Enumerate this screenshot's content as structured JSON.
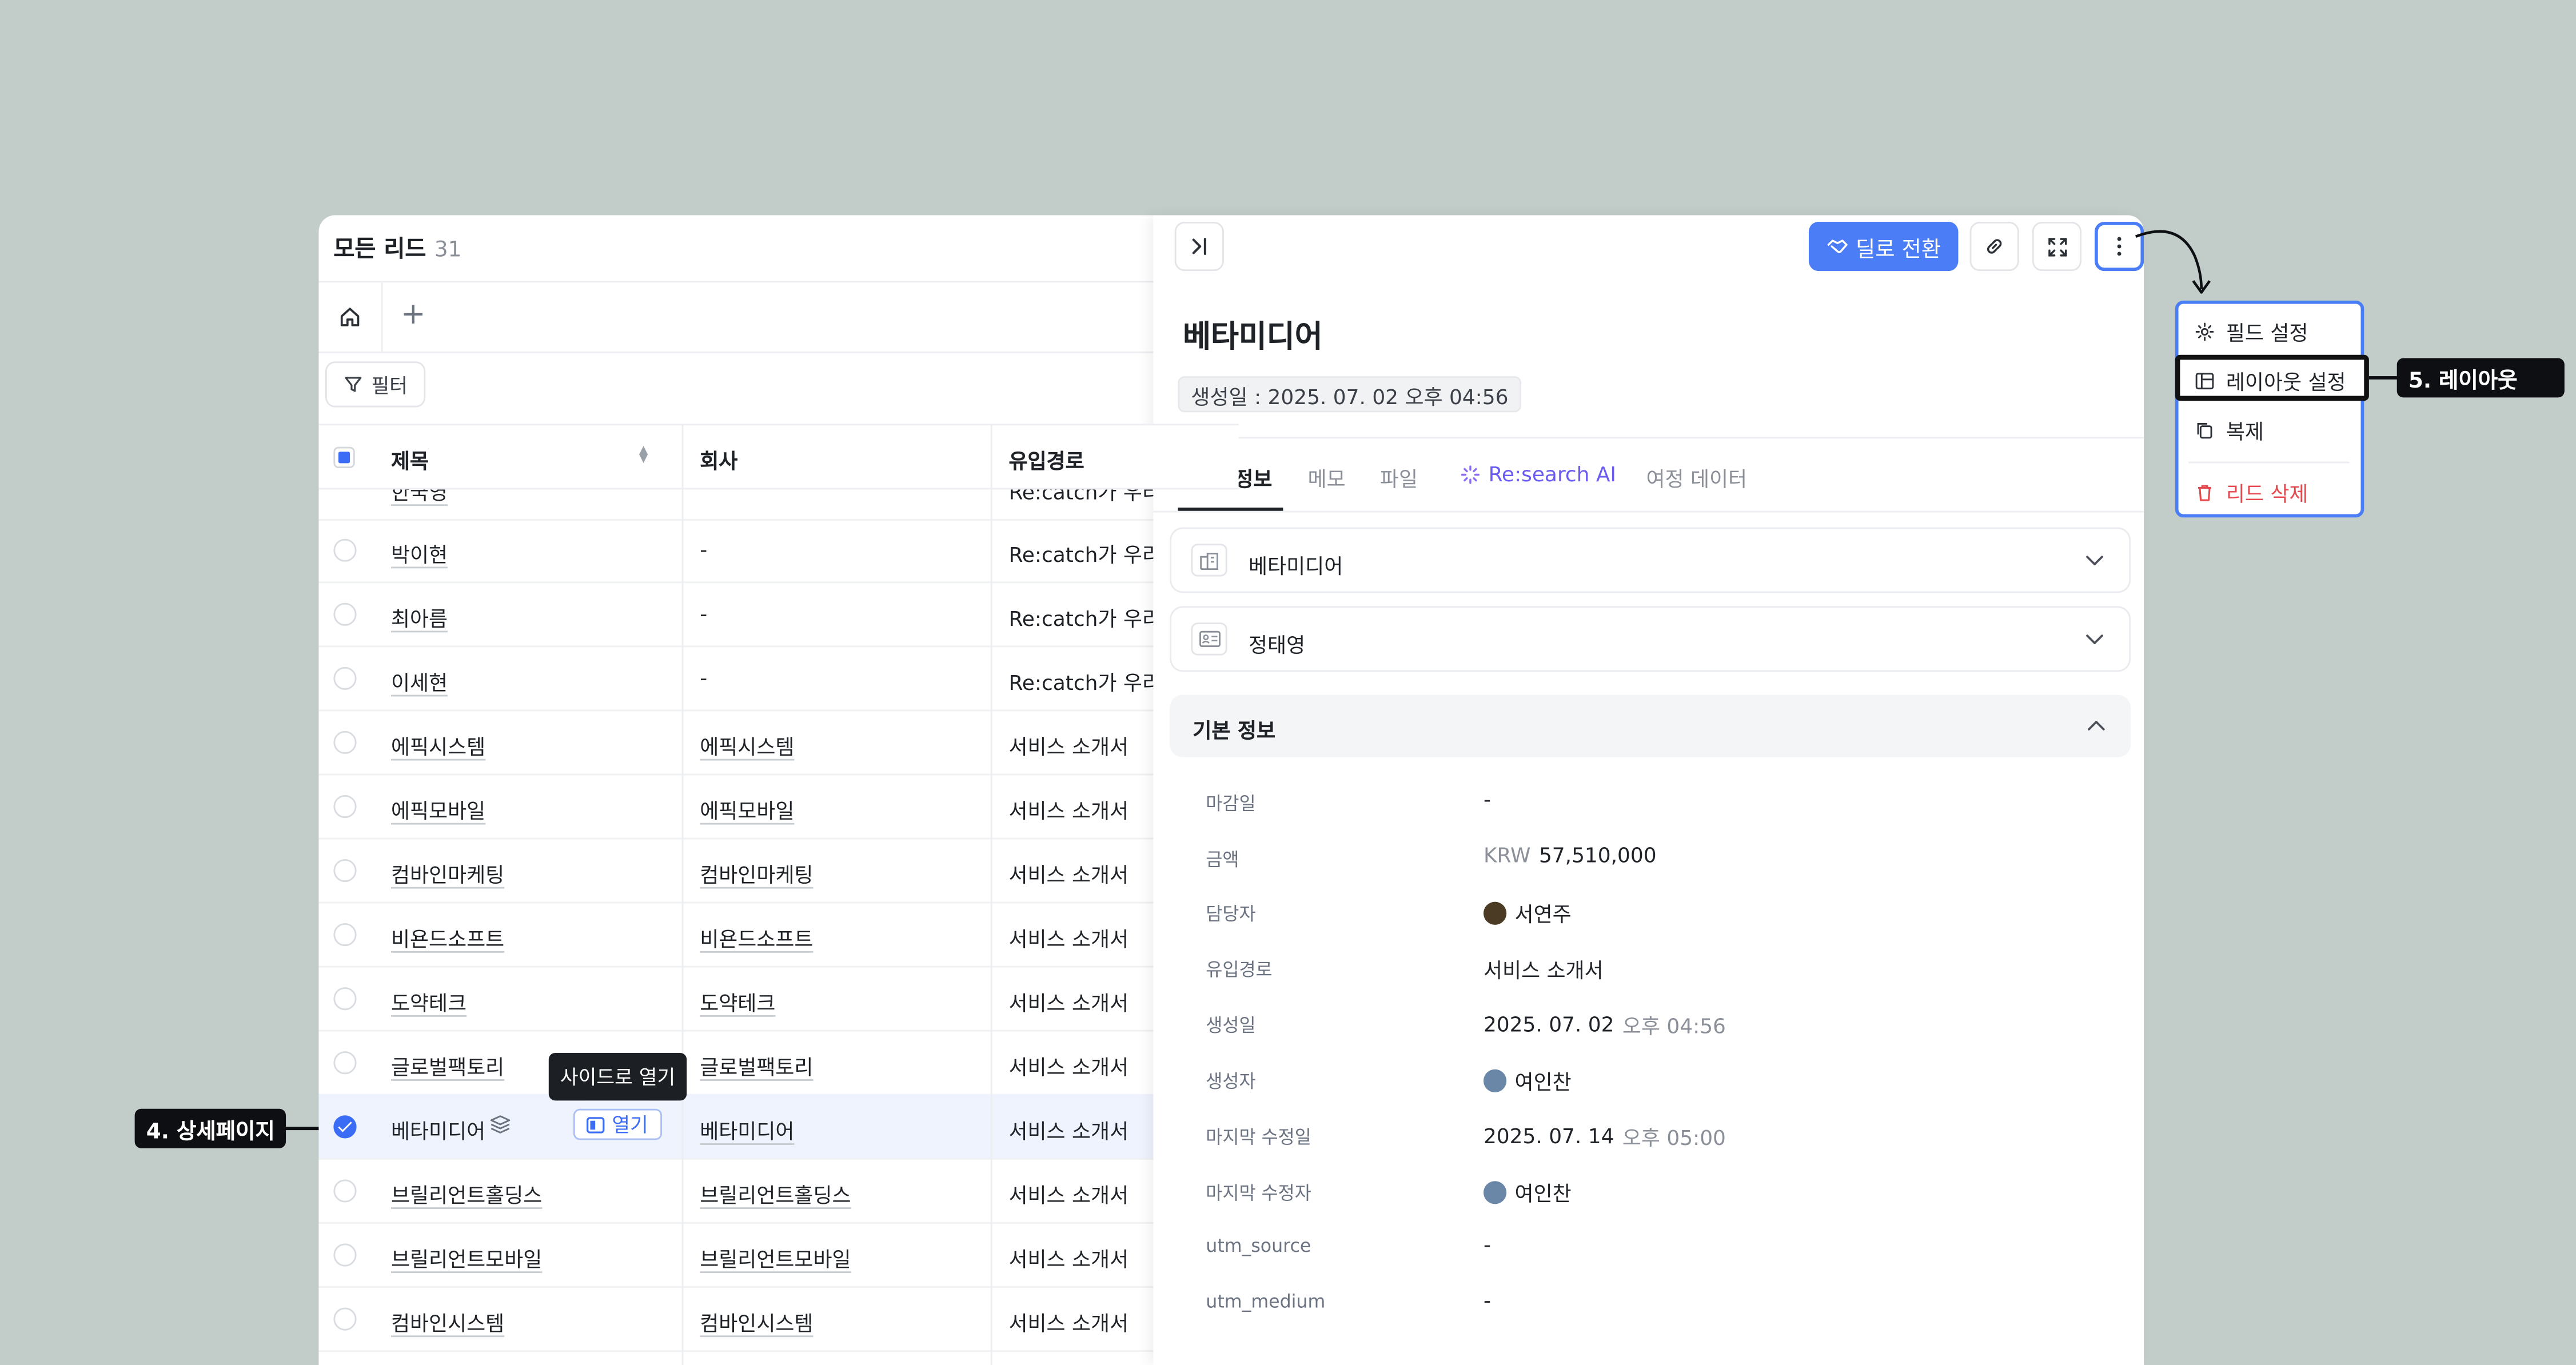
{
  "list": {
    "title": "모든 리드",
    "count": "31",
    "add_view": "+",
    "filter_label": "필터",
    "columns": {
      "title": "제목",
      "company": "회사",
      "source": "유입경로"
    },
    "partial_row": {
      "title": "한국영",
      "source": "Re:catch가 우리"
    },
    "rows": [
      {
        "title": "박이현",
        "company": "-",
        "source": "Re:catch가 우리"
      },
      {
        "title": "최아름",
        "company": "-",
        "source": "Re:catch가 우리"
      },
      {
        "title": "이세현",
        "company": "-",
        "source": "Re:catch가 우리"
      },
      {
        "title": "에픽시스템",
        "company": "에픽시스템",
        "source": "서비스 소개서"
      },
      {
        "title": "에픽모바일",
        "company": "에픽모바일",
        "source": "서비스 소개서"
      },
      {
        "title": "컴바인마케팅",
        "company": "컴바인마케팅",
        "source": "서비스 소개서"
      },
      {
        "title": "비욘드소프트",
        "company": "비욘드소프트",
        "source": "서비스 소개서"
      },
      {
        "title": "도약테크",
        "company": "도약테크",
        "source": "서비스 소개서"
      },
      {
        "title": "글로벌팩토리",
        "company": "글로벌팩토리",
        "source": "서비스 소개서"
      },
      {
        "title": "베타미디어",
        "company": "베타미디어",
        "source": "서비스 소개서",
        "selected": true
      },
      {
        "title": "브릴리언트홀딩스",
        "company": "브릴리언트홀딩스",
        "source": "서비스 소개서"
      },
      {
        "title": "브릴리언트모바일",
        "company": "브릴리언트모바일",
        "source": "서비스 소개서"
      },
      {
        "title": "컴바인시스템",
        "company": "컴바인시스템",
        "source": "서비스 소개서"
      }
    ],
    "open_label": "열기",
    "tooltip": "사이드로 열기"
  },
  "detail": {
    "convert_label": "딜로 전환",
    "title": "베타미디어",
    "created_chip": "생성일 : 2025. 07. 02 오후 04:56",
    "tabs": [
      "상세 정보",
      "메모",
      "파일",
      "Re:search AI",
      "여정 데이터"
    ],
    "cards": [
      {
        "label": "베타미디어",
        "icon": "building-icon"
      },
      {
        "label": "정태영",
        "icon": "contact-card-icon"
      }
    ],
    "section_title": "기본 정보",
    "fields": [
      {
        "label": "마감일",
        "value": "-"
      },
      {
        "label": "금액",
        "prefix": "KRW",
        "value": "57,510,000"
      },
      {
        "label": "담당자",
        "value": "서연주",
        "avatar": true
      },
      {
        "label": "유입경로",
        "value": "서비스 소개서"
      },
      {
        "label": "생성일",
        "value": "2025. 07. 02",
        "suffix": "오후 04:56"
      },
      {
        "label": "생성자",
        "value": "여인찬",
        "avatar": true
      },
      {
        "label": "마지막 수정일",
        "value": "2025. 07. 14",
        "suffix": "오후 05:00"
      },
      {
        "label": "마지막 수정자",
        "value": "여인찬",
        "avatar": true
      },
      {
        "label": "utm_source",
        "value": "-"
      },
      {
        "label": "utm_medium",
        "value": "-"
      }
    ]
  },
  "menu": {
    "items": [
      {
        "label": "필드 설정",
        "icon": "gear-icon"
      },
      {
        "label": "레이아웃 설정",
        "icon": "layout-icon"
      },
      {
        "label": "복제",
        "icon": "copy-icon"
      },
      {
        "label": "리드 삭제",
        "icon": "trash-icon",
        "danger": true
      }
    ]
  },
  "callouts": {
    "layout": "5. 레이아웃",
    "detail_page": "4. 상세페이지"
  },
  "colors": {
    "accent": "#4a7df6",
    "danger": "#e5484d",
    "background": "#c2ccc8"
  }
}
